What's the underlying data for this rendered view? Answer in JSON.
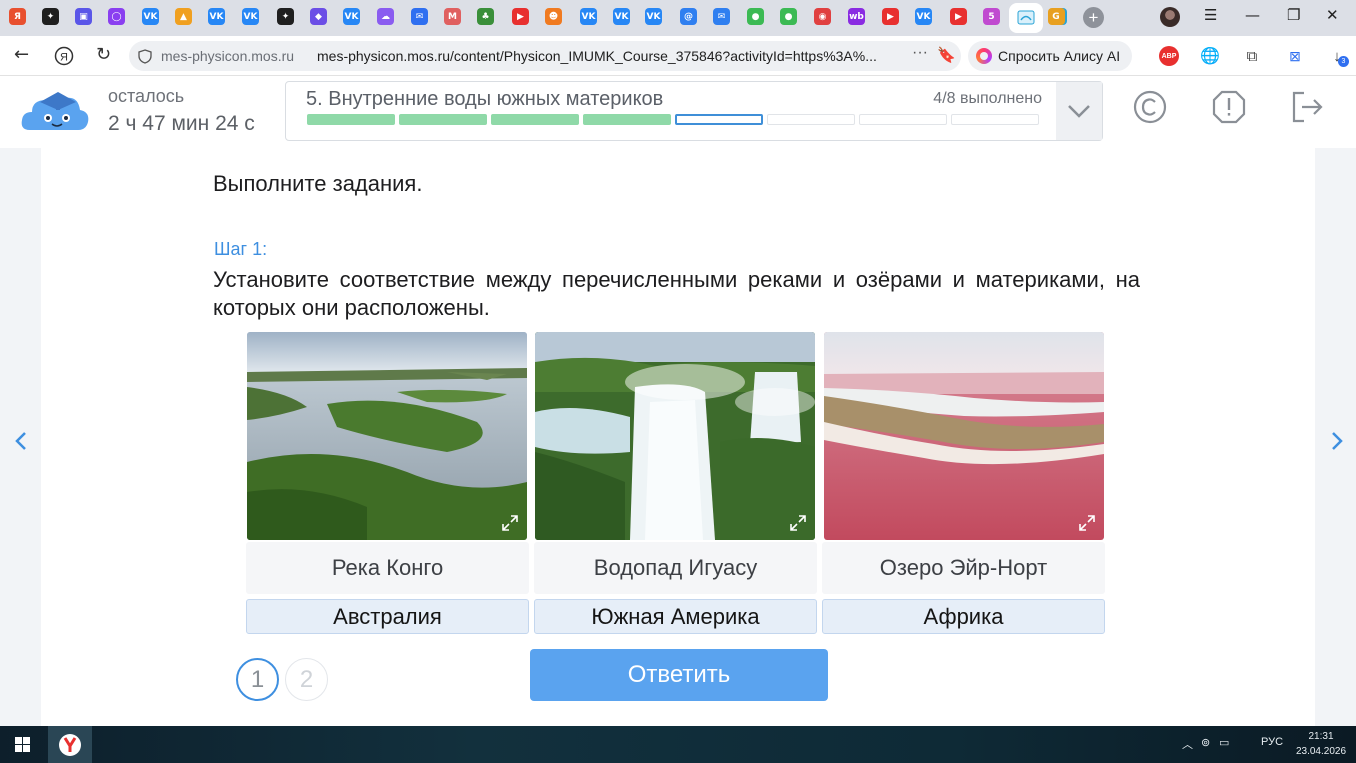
{
  "browser": {
    "url_domain": "mes-physicon.mos.ru",
    "url_full": "mes-physicon.mos.ru/content/Physicon_IMUMK_Course_375846?activityId=https%3A%...",
    "alice_button": "Спросить Алису AI",
    "more_glyph": "···",
    "bookmark_glyph": "🔖",
    "abp_label": "ABP",
    "downloads_badge": "3",
    "tab_icons": [
      {
        "color": "#e8502f",
        "glyph": "Я"
      },
      {
        "color": "#1f1f1f",
        "glyph": "✦"
      },
      {
        "color": "#5a56e8",
        "glyph": "▣"
      },
      {
        "color": "#8a3ff0",
        "glyph": "◯"
      },
      {
        "color": "#2787f5",
        "glyph": "VK"
      },
      {
        "color": "#f0a020",
        "glyph": "▲"
      },
      {
        "color": "#2787f5",
        "glyph": "VK"
      },
      {
        "color": "#2787f5",
        "glyph": "VK"
      },
      {
        "color": "#1f1f1f",
        "glyph": "✦"
      },
      {
        "color": "#6b4ee6",
        "glyph": "◆"
      },
      {
        "color": "#2787f5",
        "glyph": "VK"
      },
      {
        "color": "#8a5cf0",
        "glyph": "☁"
      },
      {
        "color": "#2f6ff0",
        "glyph": "✉"
      },
      {
        "color": "#e06060",
        "glyph": "M"
      },
      {
        "color": "#3a8f3a",
        "glyph": "♣"
      },
      {
        "color": "#e8302f",
        "glyph": "▶"
      },
      {
        "color": "#f07a20",
        "glyph": "☻"
      },
      {
        "color": "#2787f5",
        "glyph": "VK"
      },
      {
        "color": "#2787f5",
        "glyph": "VK"
      },
      {
        "color": "#2787f5",
        "glyph": "VK"
      },
      {
        "color": "#2f7ff0",
        "glyph": "@"
      },
      {
        "color": "#2f7ff0",
        "glyph": "✉"
      },
      {
        "color": "#3cba54",
        "glyph": "●"
      },
      {
        "color": "#3cba54",
        "glyph": "●"
      },
      {
        "color": "#e04040",
        "glyph": "◉"
      },
      {
        "color": "#8a2be2",
        "glyph": "wb"
      },
      {
        "color": "#e8302f",
        "glyph": "▶"
      },
      {
        "color": "#2787f5",
        "glyph": "VK"
      },
      {
        "color": "#e8302f",
        "glyph": "▶"
      },
      {
        "color": "#c04ad0",
        "glyph": "5"
      },
      {
        "color": "#29a3d6",
        "glyph": "☁"
      },
      {
        "color": "#e8a020",
        "glyph": "G"
      }
    ]
  },
  "app": {
    "time_label": "осталось",
    "time_value": "2 ч 47 мин 24 с",
    "lesson_title": "5. Внутренние воды южных материков",
    "lesson_progress": "4/8 выполнено",
    "segments_total": 8,
    "segments_done": 4,
    "segment_current": 5,
    "colors": {
      "done": "#8fd9a8",
      "current_border": "#3f8fd8",
      "todo": "#e1e4e8",
      "accent": "#3e8fe0",
      "submit": "#5aa3ef"
    }
  },
  "task": {
    "instructions": "Выполните задания.",
    "step_label": "Шаг 1:",
    "text": "Установите соответствие между перечисленными реками и озёрами и материками, на которых они расположены.",
    "items": [
      {
        "caption": "Река Конго",
        "answer": "Австралия",
        "image": "congo-river-aerial"
      },
      {
        "caption": "Водопад Игуасу",
        "answer": "Южная Америка",
        "image": "iguazu-waterfall"
      },
      {
        "caption": "Озеро Эйр-Норт",
        "answer": "Африка",
        "image": "pink-salt-lake"
      }
    ],
    "pages": [
      "1",
      "2"
    ],
    "current_page": "1",
    "submit_label": "Ответить"
  },
  "taskbar": {
    "language": "РУС",
    "time": "21:31",
    "date": "23.04.2026"
  }
}
